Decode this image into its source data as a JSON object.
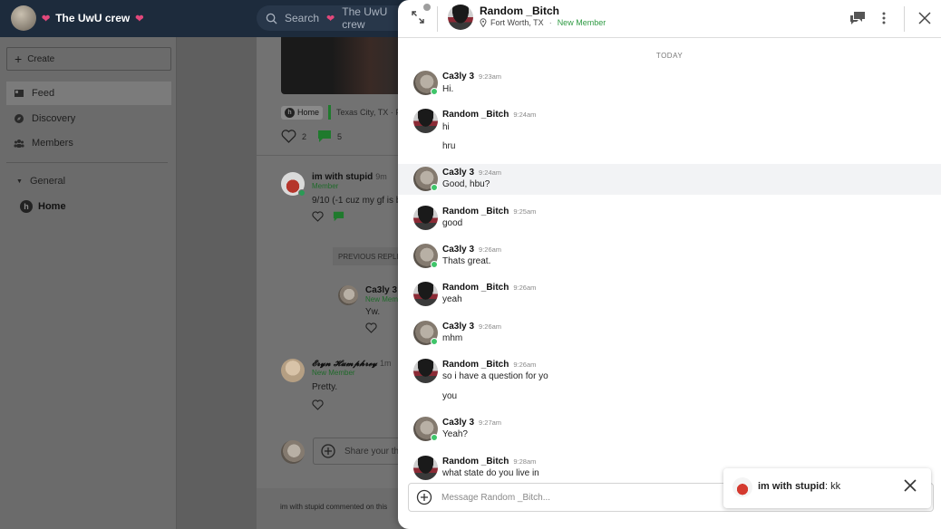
{
  "app": {
    "group_name": "The UwU crew",
    "search_placeholder": "Search",
    "search_group": "The UwU crew"
  },
  "sidebar": {
    "create_label": "Create",
    "items": [
      {
        "label": "Feed",
        "icon": "feed-icon",
        "active": true
      },
      {
        "label": "Discovery",
        "icon": "compass-icon",
        "active": false
      },
      {
        "label": "Members",
        "icon": "members-icon",
        "active": false
      }
    ],
    "section_label": "General",
    "home_label": "Home"
  },
  "feed": {
    "tag_home": "Home",
    "tag_location": "Texas City, TX · Po",
    "likes": "2",
    "comments": "5",
    "comment1": {
      "name": "im with stupid",
      "time": "9m",
      "role": "Member",
      "text": "9/10 (-1 cuz my gf is b"
    },
    "previous_replies": "PREVIOUS REPLIES",
    "reply1": {
      "name": "Ca3ly 3",
      "role": "New Mem",
      "text": "Yw."
    },
    "comment2": {
      "name": "𝓔𝓻𝔂𝓷 𝓗𝓾𝓶𝓹𝓱𝓻𝓮𝔂",
      "time": "1m",
      "role": "New Member",
      "text": "Pretty."
    },
    "share_placeholder": "Share your th",
    "footer_text": "im with stupid commented on this"
  },
  "chat": {
    "name": "Random _Bitch",
    "location": "Fort Worth, TX",
    "badge": "New Member",
    "day_label": "TODAY",
    "messages": [
      {
        "sender": "Ca3ly 3",
        "time": "9:23am",
        "lines": [
          "Hi."
        ]
      },
      {
        "sender": "Random _Bitch",
        "time": "9:24am",
        "lines": [
          "hi",
          "hru"
        ]
      },
      {
        "sender": "Ca3ly 3",
        "time": "9:24am",
        "lines": [
          "Good, hbu?"
        ]
      },
      {
        "sender": "Random _Bitch",
        "time": "9:25am",
        "lines": [
          "good"
        ]
      },
      {
        "sender": "Ca3ly 3",
        "time": "9:26am",
        "lines": [
          "Thats great."
        ]
      },
      {
        "sender": "Random _Bitch",
        "time": "9:26am",
        "lines": [
          "yeah"
        ]
      },
      {
        "sender": "Ca3ly 3",
        "time": "9:26am",
        "lines": [
          "mhm"
        ]
      },
      {
        "sender": "Random _Bitch",
        "time": "9:26am",
        "lines": [
          "so i have a question for yo",
          "you"
        ]
      },
      {
        "sender": "Ca3ly 3",
        "time": "9:27am",
        "lines": [
          "Yeah?"
        ]
      },
      {
        "sender": "Random _Bitch",
        "time": "9:28am",
        "lines": [
          "what state do you live in"
        ]
      }
    ],
    "composer_placeholder": "Message Random _Bitch..."
  },
  "toast": {
    "name": "im with stupid",
    "text": "kk"
  }
}
